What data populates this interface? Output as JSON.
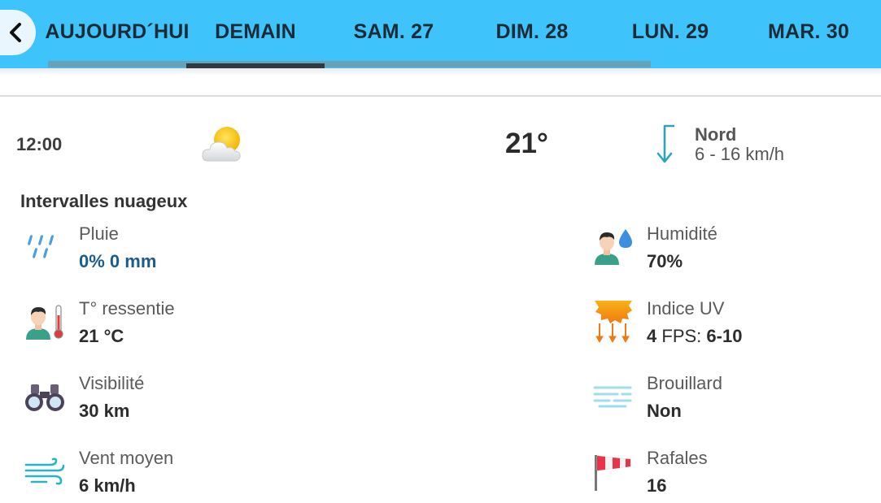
{
  "tabs": [
    {
      "label": "AUJOURD´HUI",
      "active": false
    },
    {
      "label": "DEMAIN",
      "active": true
    },
    {
      "label": "SAM. 27",
      "active": false
    },
    {
      "label": "DIM. 28",
      "active": false
    },
    {
      "label": "LUN. 29",
      "active": false
    },
    {
      "label": "MAR. 30",
      "active": false
    }
  ],
  "summary": {
    "time": "12:00",
    "sky_icon": "partly-cloudy-icon",
    "temperature": "21°",
    "wind_direction": "Nord",
    "wind_speed": "6 - 16 km/h",
    "condition": "Intervalles nuageux"
  },
  "details": {
    "rain": {
      "label": "Pluie",
      "value": "0% 0 mm",
      "icon": "rain-drops-icon"
    },
    "feels_like": {
      "label": "T° ressentie",
      "value": "21 °C",
      "icon": "thermometer-person-icon"
    },
    "visibility": {
      "label": "Visibilité",
      "value": "30 km",
      "icon": "binoculars-icon"
    },
    "avg_wind": {
      "label": "Vent moyen",
      "value": "6 km/h",
      "icon": "wind-icon"
    },
    "humidity": {
      "label": "Humidité",
      "value": "70%",
      "icon": "humidity-person-icon"
    },
    "uv": {
      "label": "Indice UV",
      "value_num": "4",
      "fps_label": "FPS:",
      "fps_value": "6-10",
      "icon": "uv-sun-icon"
    },
    "fog": {
      "label": "Brouillard",
      "value": "Non",
      "icon": "fog-icon"
    },
    "gusts": {
      "label": "Rafales",
      "value": "16",
      "icon": "windsock-icon"
    }
  },
  "colors": {
    "header": "#3ec3fb",
    "rain_value": "#1a5c8f",
    "wind_arrow": "#2aa6b8",
    "active_tab_indicator": "#2e3a40"
  }
}
